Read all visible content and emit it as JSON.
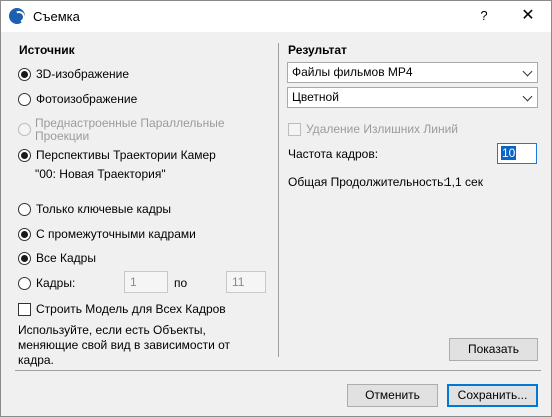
{
  "window": {
    "title": "Съемка",
    "help_label": "?",
    "close_label": "✕"
  },
  "source": {
    "title": "Источник",
    "options": {
      "image3d": "3D-изображение",
      "photo": "Фотоизображение",
      "parallel": "Преднастроенные Параллельные Проекции",
      "perspective": "Перспективы Траектории Камер"
    },
    "path_name": "\"00: Новая Траектория\"",
    "frames_mode": {
      "key_only": "Только ключевые кадры",
      "intermediate": "С промежуточными кадрами"
    },
    "frames_range": {
      "all": "Все Кадры",
      "range": "Кадры:",
      "from": "1",
      "to_label": "по",
      "to": "11"
    },
    "build_model_label": "Строить Модель для Всех Кадров",
    "hint": "Используйте, если есть Объекты, меняющие свой вид в зависимости от кадра."
  },
  "result": {
    "title": "Результат",
    "format": "Файлы фильмов MP4",
    "color": "Цветной",
    "remove_lines_label": "Удаление Излишних Линий",
    "framerate_label": "Частота кадров:",
    "framerate_value": "10",
    "duration_label": "Общая Продолжительность:",
    "duration_value": "1,1 сек",
    "show_button": "Показать"
  },
  "footer": {
    "cancel": "Отменить",
    "save": "Сохранить..."
  }
}
